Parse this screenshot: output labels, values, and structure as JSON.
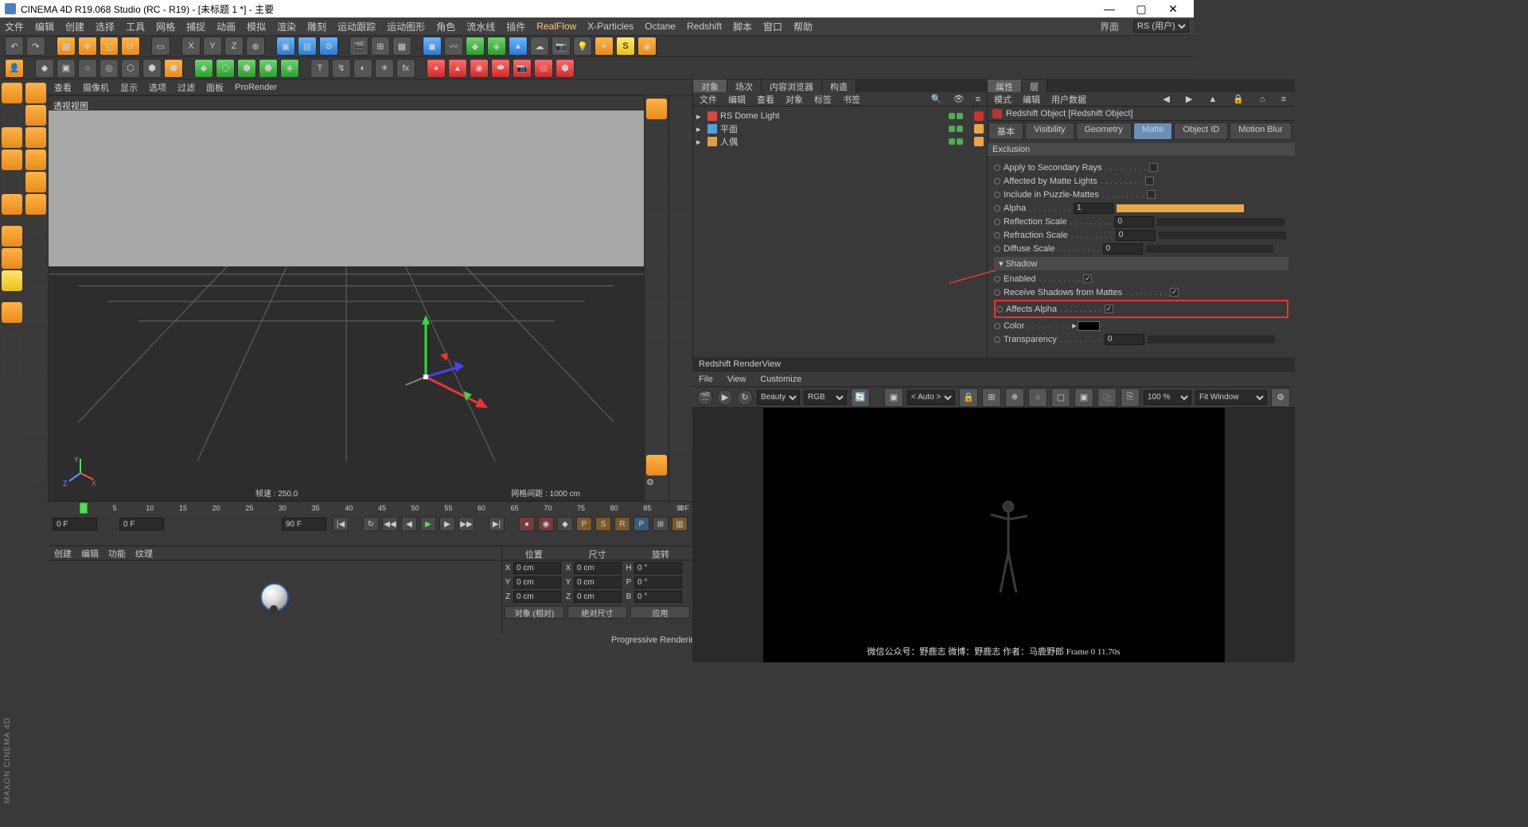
{
  "title": "CINEMA 4D R19.068 Studio (RC - R19) - [未标题 1 *] - 主要",
  "menubar": [
    "文件",
    "编辑",
    "创建",
    "选择",
    "工具",
    "网格",
    "捕捉",
    "动画",
    "模拟",
    "渲染",
    "雕刻",
    "运动跟踪",
    "运动图形",
    "角色",
    "流水线",
    "插件",
    "RealFlow",
    "X-Particles",
    "Octane",
    "Redshift",
    "脚本",
    "窗口",
    "帮助"
  ],
  "layout_label": "界面",
  "layout_value": "RS (用户)",
  "viewport_menu": [
    "查看",
    "摄像机",
    "显示",
    "选项",
    "过滤",
    "面板",
    "ProRender"
  ],
  "viewport_label": "透视视图",
  "vp_footer_left": "帧速 : 250.0",
  "vp_footer_right": "网格间距 : 1000 cm",
  "ruler_start": 0,
  "ruler_end": 90,
  "ruler_end_label": "0 F",
  "frame_cur": "0 F",
  "frame_cur2": "0 F",
  "frame_end": "90 F",
  "mat_menu": [
    "创建",
    "编辑",
    "功能",
    "纹理"
  ],
  "coord_heads": [
    "位置",
    "尺寸",
    "旋转"
  ],
  "coord_rows": [
    {
      "l": "X",
      "p": "0 cm",
      "s": "0 cm",
      "r": "0 °",
      "h": "H"
    },
    {
      "l": "Y",
      "p": "0 cm",
      "s": "0 cm",
      "r": "0 °",
      "h": "P"
    },
    {
      "l": "Z",
      "p": "0 cm",
      "s": "0 cm",
      "r": "0 °",
      "h": "B"
    }
  ],
  "coord_btns": [
    "对象 (相对)",
    "绝对尺寸",
    "应用"
  ],
  "obj_tabs": [
    "对象",
    "场次",
    "内容浏览器",
    "构造"
  ],
  "obj_menu": [
    "文件",
    "编辑",
    "查看",
    "对象",
    "标签",
    "书签"
  ],
  "objects": [
    {
      "name": "RS Dome Light",
      "icon": "#d44",
      "tag": "red"
    },
    {
      "name": "平面",
      "icon": "#4aa2e0",
      "tag": "orange"
    },
    {
      "name": "人偶",
      "icon": "#e0a040",
      "tag": "orange"
    }
  ],
  "attr_tabs": [
    "属性",
    "层"
  ],
  "attr_menu": [
    "模式",
    "编辑",
    "用户数据"
  ],
  "attr_title": "Redshift Object [Redshift Object]",
  "attr_subtabs": [
    "基本",
    "Visibility",
    "Geometry",
    "Matte",
    "Object ID",
    "Motion Blur"
  ],
  "attr_active_subtab": "Matte",
  "attr_sections": {
    "exclusion": "Exclusion",
    "shadow": "Shadow",
    "lines1": [
      {
        "label": "Apply to Secondary Rays",
        "type": "chk",
        "val": false
      },
      {
        "label": "Affected by Matte Lights",
        "type": "chk",
        "val": false
      },
      {
        "label": "Include in Puzzle-Mattes",
        "type": "chk",
        "val": false
      },
      {
        "label": "Alpha",
        "type": "numslider",
        "val": "1",
        "fill": 100
      },
      {
        "label": "Reflection Scale",
        "type": "numslider",
        "val": "0",
        "fill": 0
      },
      {
        "label": "Refraction Scale",
        "type": "numslider",
        "val": "0",
        "fill": 0
      },
      {
        "label": "Diffuse Scale",
        "type": "numslider",
        "val": "0",
        "fill": 0
      }
    ],
    "lines2": [
      {
        "label": "Enabled",
        "type": "chk",
        "val": true
      },
      {
        "label": "Receive Shadows from Mattes",
        "type": "chk",
        "val": true
      },
      {
        "label": "Affects Alpha",
        "type": "chk",
        "val": true,
        "highlight": true
      },
      {
        "label": "Color",
        "type": "color",
        "val": "#000000"
      },
      {
        "label": "Transparency",
        "type": "numslider",
        "val": "0",
        "fill": 0
      }
    ]
  },
  "rv_title": "Redshift RenderView",
  "rv_menu": [
    "File",
    "View",
    "Customize"
  ],
  "rv_aov": "Beauty",
  "rv_rgb": "RGB",
  "rv_auto": "< Auto >",
  "rv_zoom": "100 %",
  "rv_fit": "Fit Window",
  "rv_caption": "微信公众号：野鹿志   微博：野鹿志   作者：马鹿野郎   Frame   0   11.70s",
  "status": "Progressive Rendering...",
  "maxon": "MAXON CINEMA 4D"
}
